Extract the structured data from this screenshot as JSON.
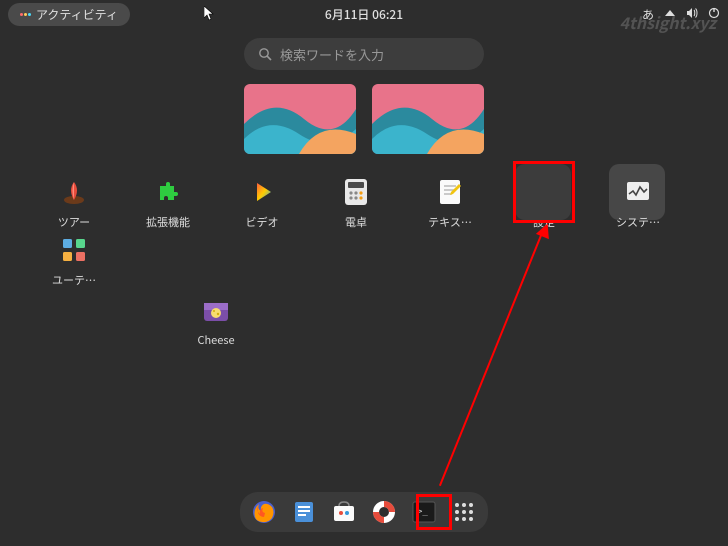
{
  "topbar": {
    "activities_label": "アクティビティ",
    "datetime": "6月11日 06:21",
    "input_method": "あ"
  },
  "watermark": "4thsight.xyz",
  "search": {
    "placeholder": "検索ワードを入力"
  },
  "apps": [
    {
      "label": "ツアー"
    },
    {
      "label": "拡張機能"
    },
    {
      "label": "ビデオ"
    },
    {
      "label": "電卓"
    },
    {
      "label": "テキス…"
    },
    {
      "label": "設定"
    },
    {
      "label": "システ…"
    },
    {
      "label": "ユーテ…"
    },
    {
      "label": "Cheese"
    }
  ],
  "dock": {
    "items": [
      "firefox",
      "files",
      "software",
      "help",
      "terminal",
      "show-apps"
    ]
  }
}
